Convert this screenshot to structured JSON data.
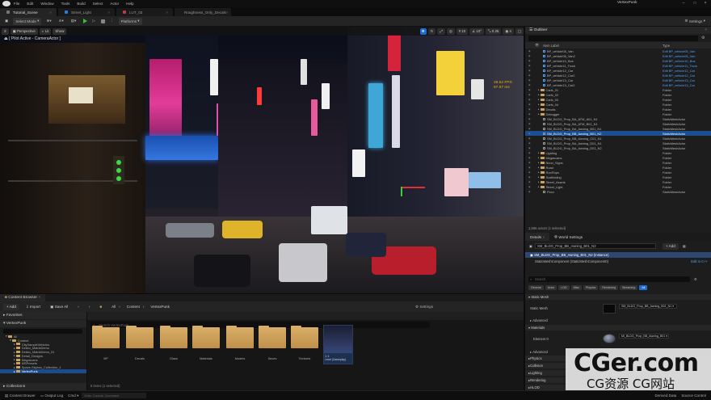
{
  "window": {
    "title": "VertexPunk"
  },
  "menu": [
    "File",
    "Edit",
    "Window",
    "Tools",
    "Build",
    "Select",
    "Actor",
    "Help"
  ],
  "tabs": [
    {
      "label": "Tutorial_Scene"
    },
    {
      "label": "Street_Light"
    },
    {
      "label": "LUT_03"
    },
    {
      "label": "Roughness_Only_Decals"
    }
  ],
  "toolbar": {
    "select_mode": "Select Mode",
    "platforms": "Platforms",
    "settings": "Settings"
  },
  "viewport": {
    "mode_label": "Perspective",
    "lit_label": "Lit",
    "show_label": "Show",
    "pilot_text": "[ Pilot Active - CameraActor ]",
    "fps_line1": "28.52 FPS",
    "fps_line2": "87.67 ms",
    "snap_value": "10",
    "rot_value": "10°",
    "scale_value": "0.25",
    "cam_speed": "4"
  },
  "content_browser": {
    "tab_label": "Content Browser",
    "add_label": "+ Add",
    "import_label": "Import",
    "save_all_label": "Save All",
    "path": [
      "All",
      "Content",
      "VertexPunk"
    ],
    "settings_label": "Settings",
    "search_placeholder": "Search VertexPunk",
    "favorites_label": "Favorites",
    "project_label": "VertexPunk",
    "tree": [
      {
        "label": "All",
        "indent": 1,
        "selected": false
      },
      {
        "label": "Content",
        "indent": 2,
        "selected": false
      },
      {
        "label": "CitySampleVehicles",
        "indent": 3,
        "selected": false
      },
      {
        "label": "Dekko_MatrixDemo",
        "indent": 3,
        "selected": false
      },
      {
        "label": "Dekko_MatrixDemo_01",
        "indent": 3,
        "selected": false
      },
      {
        "label": "Detail_Designs",
        "indent": 3,
        "selected": false
      },
      {
        "label": "Megascans",
        "indent": 3,
        "selected": false
      },
      {
        "label": "MSPresets",
        "indent": 3,
        "selected": false
      },
      {
        "label": "Space-Skybox_Collection_1",
        "indent": 3,
        "selected": false
      },
      {
        "label": "VertexPunk",
        "indent": 3,
        "selected": true
      }
    ],
    "collections_label": "Collections",
    "assets": [
      "BP",
      "Decals",
      "Glass",
      "Materials",
      "Models",
      "Saves",
      "Textures"
    ],
    "map_asset": {
      "title": "1.1",
      "subtitle": "Level (Gameplay)"
    },
    "status": "8 items (1 selected)"
  },
  "bottom_bar": {
    "content_drawer": "Content Drawer",
    "output_log": "Output Log",
    "cmd_label": "Cmd",
    "cmd_placeholder": "Enter Console Command",
    "derived_data": "Derived Data",
    "source_control": "Source Control"
  },
  "outliner": {
    "title": "Outliner",
    "col_label": "Item Label",
    "col_type": "Type",
    "rows": [
      {
        "label": "BP_vehicle05_Van",
        "indent": 3,
        "kind": "actor",
        "type": "Edit BP_vehicle05_Van",
        "link": true,
        "selected": false
      },
      {
        "label": "BP_vehicle05_Van2",
        "indent": 3,
        "kind": "actor",
        "type": "Edit BP_vehicle05_Van",
        "link": true,
        "selected": false
      },
      {
        "label": "BP_vehicle10_Bus",
        "indent": 3,
        "kind": "actor",
        "type": "Edit BP_vehicle10_Bus",
        "link": true,
        "selected": false
      },
      {
        "label": "BP_vehicle11_Truck",
        "indent": 3,
        "kind": "actor",
        "type": "Edit BP_vehicle11_Truck",
        "link": true,
        "selected": false
      },
      {
        "label": "BP_vehicle12_Car",
        "indent": 3,
        "kind": "actor",
        "type": "Edit BP_vehicle12_Car",
        "link": true,
        "selected": false
      },
      {
        "label": "BP_vehicle12_Car2",
        "indent": 3,
        "kind": "actor",
        "type": "Edit BP_vehicle12_Car",
        "link": true,
        "selected": false
      },
      {
        "label": "BP_vehicle13_Car",
        "indent": 3,
        "kind": "actor",
        "type": "Edit BP_vehicle13_Car",
        "link": true,
        "selected": false
      },
      {
        "label": "BP_vehicle13_Car2",
        "indent": 3,
        "kind": "actor",
        "type": "Edit BP_vehicle13_Car",
        "link": true,
        "selected": false
      },
      {
        "label": "Carls_01",
        "indent": 2,
        "kind": "folder",
        "type": "Folder",
        "link": false,
        "selected": false
      },
      {
        "label": "Carls_02",
        "indent": 2,
        "kind": "folder",
        "type": "Folder",
        "link": false,
        "selected": false
      },
      {
        "label": "Carls_03",
        "indent": 2,
        "kind": "folder",
        "type": "Folder",
        "link": false,
        "selected": false
      },
      {
        "label": "Carls_04",
        "indent": 2,
        "kind": "folder",
        "type": "Folder",
        "link": false,
        "selected": false
      },
      {
        "label": "Decals",
        "indent": 2,
        "kind": "folder",
        "type": "Folder",
        "link": false,
        "selected": false
      },
      {
        "label": "Debugger",
        "indent": 2,
        "kind": "folder",
        "type": "Folder",
        "link": false,
        "selected": false
      },
      {
        "label": "SM_BLDG_Prop_BA_ATM_A01_N1",
        "indent": 3,
        "kind": "mesh",
        "type": "StaticMeshActor",
        "link": false,
        "selected": false
      },
      {
        "label": "SM_BLDG_Prop_BA_ATM_B01_N1",
        "indent": 3,
        "kind": "mesh",
        "type": "StaticMeshActor",
        "link": false,
        "selected": false
      },
      {
        "label": "SM_BLDG_Prop_BA_Awning_B01_N1",
        "indent": 3,
        "kind": "mesh",
        "type": "StaticMeshActor",
        "link": false,
        "selected": false
      },
      {
        "label": "SM_BLDG_Prop_BB_Awning_B01_N2",
        "indent": 3,
        "kind": "mesh",
        "type": "StaticMeshActor",
        "link": false,
        "selected": true
      },
      {
        "label": "SM_BLDG_Prop_BB_Awning_C01_N1",
        "indent": 3,
        "kind": "mesh",
        "type": "StaticMeshActor",
        "link": false,
        "selected": false
      },
      {
        "label": "SM_BLDG_Prop_BA_Awning_D01_N1",
        "indent": 3,
        "kind": "mesh",
        "type": "StaticMeshActor",
        "link": false,
        "selected": false
      },
      {
        "label": "SM_BLDG_Prop_BA_Awning_D01_N2",
        "indent": 3,
        "kind": "mesh",
        "type": "StaticMeshActor",
        "link": false,
        "selected": false
      },
      {
        "label": "Lighting",
        "indent": 2,
        "kind": "folder",
        "type": "Folder",
        "link": false,
        "selected": false
      },
      {
        "label": "Megascans",
        "indent": 2,
        "kind": "folder",
        "type": "Folder",
        "link": false,
        "selected": false
      },
      {
        "label": "Neon_Signs",
        "indent": 2,
        "kind": "folder",
        "type": "Folder",
        "link": false,
        "selected": false
      },
      {
        "label": "Road",
        "indent": 2,
        "kind": "folder",
        "type": "Folder",
        "link": false,
        "selected": false
      },
      {
        "label": "RoofTops",
        "indent": 2,
        "kind": "folder",
        "type": "Folder",
        "link": false,
        "selected": false
      },
      {
        "label": "Scaffolding",
        "indent": 2,
        "kind": "folder",
        "type": "Folder",
        "link": false,
        "selected": false
      },
      {
        "label": "Street_Assets",
        "indent": 2,
        "kind": "folder",
        "type": "Folder",
        "link": false,
        "selected": false
      },
      {
        "label": "Street_Light",
        "indent": 2,
        "kind": "folder",
        "type": "Folder",
        "link": false,
        "selected": false
      },
      {
        "label": "Floor",
        "indent": 3,
        "kind": "mesh",
        "type": "StaticMeshActor",
        "link": false,
        "selected": false
      }
    ],
    "status": "1,565 actors (1 selected)"
  },
  "details": {
    "tab_details": "Details",
    "tab_world": "World Settings",
    "actor_name": "SM_BLDG_Prop_BB_Awning_B01_N2",
    "add_label": "+ Add",
    "instance_label": "SM_BLDG_Prop_BB_Awning_B01_N2 (Instance)",
    "component_label": "StaticMeshComponent (StaticMeshComponent0)",
    "edit_in_cpp": "Edit in C++",
    "search_placeholder": "Search",
    "filter_tabs": [
      "General",
      "Actor",
      "LOD",
      "Misc",
      "Physics",
      "Rendering",
      "Streaming",
      "All"
    ],
    "static_mesh_cat": "Static Mesh",
    "static_mesh_label": "Static Mesh",
    "static_mesh_value": "SM_BLDG_Prop_BB_Awning_B01_N1",
    "advanced1": "Advanced",
    "materials_cat": "Materials",
    "element_label": "Element 0",
    "element_value": "MI_BLDG_Prop_BB_Awning_B01",
    "advanced2": "Advanced",
    "more_cats": [
      "Physics",
      "Collision",
      "Lighting",
      "Rendering",
      "HLOD"
    ]
  },
  "watermark": {
    "line1": "CGer.com",
    "line2": "CG资源 CG网站"
  },
  "colors": {
    "selection": "#1b4f92",
    "accent_blue": "#1b6ed6",
    "folder": "#c9a25f"
  }
}
